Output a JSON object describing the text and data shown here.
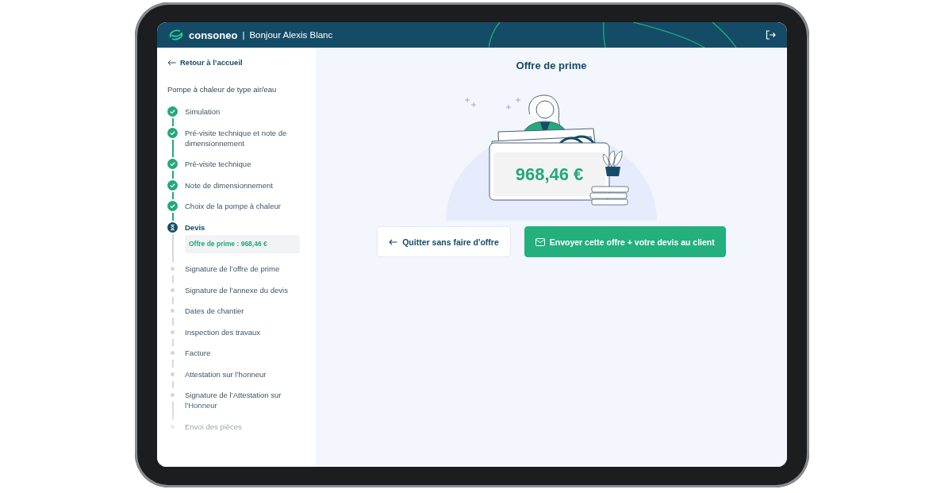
{
  "header": {
    "brand": "consoneo",
    "separator": "|",
    "greeting": "Bonjour Alexis Blanc"
  },
  "sidebar": {
    "back_link": "Retour à l’accueil",
    "project": "Pompe à chaleur de type air/eau",
    "steps": [
      {
        "label": "Simulation",
        "done": true,
        "current": false
      },
      {
        "label": "Pré-visite technique et note de dimensionnement",
        "done": true,
        "current": false
      },
      {
        "label": "Pré-visite technique",
        "done": true,
        "current": false
      },
      {
        "label": "Note de dimensionnement",
        "done": true,
        "current": false
      },
      {
        "label": "Choix de la pompe à chaleur",
        "done": true,
        "current": false
      },
      {
        "label": "Devis",
        "done": false,
        "current": true,
        "detail": "Offre de prime : 968,46 €"
      },
      {
        "label": "Signature de l’offre de prime",
        "done": false,
        "current": false
      },
      {
        "label": "Signature de l’annexe du devis",
        "done": false,
        "current": false
      },
      {
        "label": "Dates de chantier",
        "done": false,
        "current": false
      },
      {
        "label": "Inspection des travaux",
        "done": false,
        "current": false
      },
      {
        "label": "Facture",
        "done": false,
        "current": false
      },
      {
        "label": "Attestation sur l’honneur",
        "done": false,
        "current": false
      },
      {
        "label": "Signature de l’Attestation sur l’Honneur",
        "done": false,
        "current": false
      },
      {
        "label": "Envoi des pièces",
        "done": false,
        "current": false
      }
    ]
  },
  "main": {
    "title": "Offre de prime",
    "amount": "968,46 €",
    "buttons": [
      {
        "kind": "secondary",
        "label": "Quitter sans faire d'offre"
      },
      {
        "kind": "primary",
        "label": "Envoyer cette offre + votre devis au client"
      }
    ]
  }
}
